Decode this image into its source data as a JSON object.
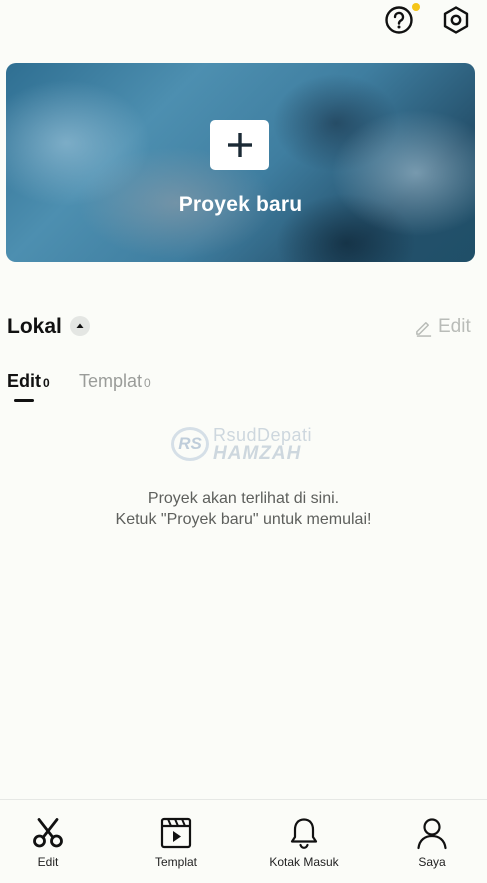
{
  "topbar": {
    "help_icon": "question-circle-icon",
    "settings_icon": "hexagon-gear-icon",
    "notification_dot_color": "#f5c518"
  },
  "hero": {
    "label": "Proyek baru",
    "icon": "plus-icon"
  },
  "section": {
    "title": "Lokal",
    "sort_icon": "caret-up-icon",
    "edit_label": "Edit",
    "edit_icon": "pencil-icon"
  },
  "tabs": [
    {
      "label": "Edit",
      "count": "0",
      "active": true
    },
    {
      "label": "Templat",
      "count": "0",
      "active": false
    }
  ],
  "watermark": {
    "logo": "RS",
    "line1": "RsudDepati",
    "line2": "HAMZAH"
  },
  "empty_state": {
    "line1": "Proyek akan terlihat di sini.",
    "line2": "Ketuk \"Proyek baru\" untuk memulai!"
  },
  "bottom_nav": [
    {
      "label": "Edit",
      "icon": "scissors-icon",
      "active": true
    },
    {
      "label": "Templat",
      "icon": "clapperboard-icon",
      "active": false
    },
    {
      "label": "Kotak Masuk",
      "icon": "bell-icon",
      "active": false
    },
    {
      "label": "Saya",
      "icon": "person-icon",
      "active": false
    }
  ]
}
